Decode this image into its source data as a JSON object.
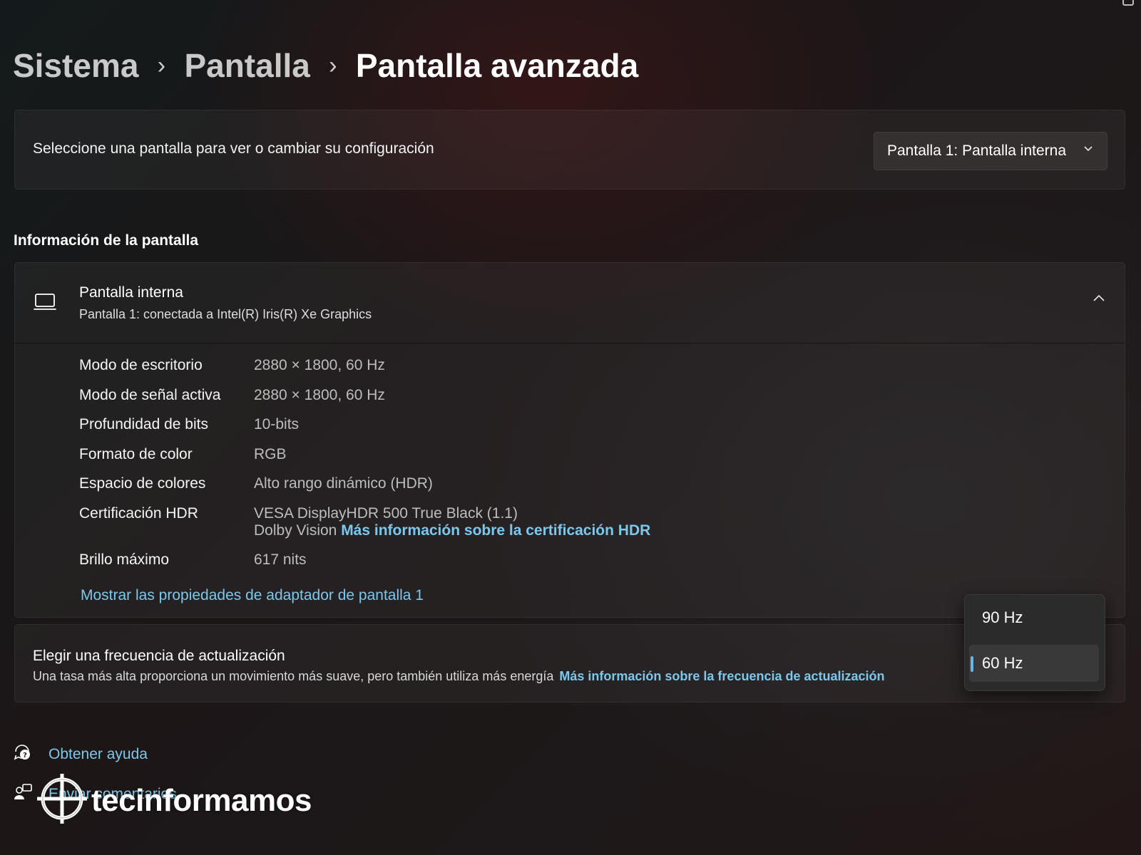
{
  "breadcrumb": {
    "items": [
      "Sistema",
      "Pantalla",
      "Pantalla avanzada"
    ]
  },
  "display_select": {
    "label": "Seleccione una pantalla para ver o cambiar su configuración",
    "selected": "Pantalla 1: Pantalla interna"
  },
  "section": {
    "title": "Información de la pantalla"
  },
  "display_info": {
    "title": "Pantalla interna",
    "subtitle": "Pantalla 1: conectada a Intel(R) Iris(R) Xe Graphics",
    "rows": [
      {
        "key": "Modo de escritorio",
        "value": "2880 × 1800, 60 Hz"
      },
      {
        "key": "Modo de señal activa",
        "value": "2880 × 1800, 60 Hz"
      },
      {
        "key": "Profundidad de bits",
        "value": "10-bits"
      },
      {
        "key": "Formato de color",
        "value": "RGB"
      },
      {
        "key": "Espacio de colores",
        "value": "Alto rango dinámico (HDR)"
      }
    ],
    "hdr": {
      "key": "Certificación HDR",
      "value_line1": "VESA DisplayHDR 500 True Black (1.1)",
      "value_line2": "Dolby Vision",
      "link": "Más información sobre la certificación HDR"
    },
    "brightness": {
      "key": "Brillo máximo",
      "value": "617 nits"
    },
    "adapter_link": "Mostrar las propiedades de adaptador de pantalla 1"
  },
  "refresh": {
    "title": "Elegir una frecuencia de actualización",
    "subtitle": "Una tasa más alta proporciona un movimiento más suave, pero también utiliza más energía",
    "link": "Más información sobre la frecuencia de actualización",
    "options": [
      "90 Hz",
      "60 Hz"
    ],
    "selected": "60 Hz"
  },
  "footer": {
    "help": "Obtener ayuda",
    "feedback": "Enviar comentarios"
  },
  "watermark": {
    "text": "tecinformamos"
  },
  "colors": {
    "accent": "#63b7ea",
    "link": "#7cc8ec"
  }
}
